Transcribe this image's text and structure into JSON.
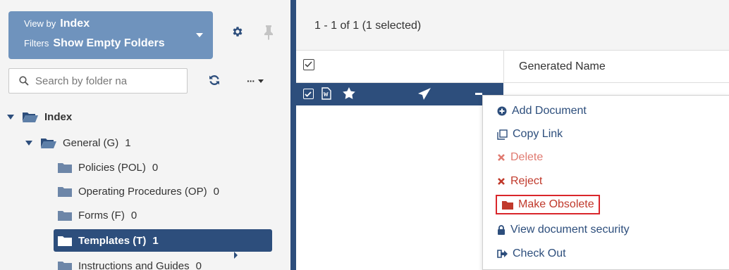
{
  "view_box": {
    "view_by_label": "View by",
    "view_by_value": "Index",
    "filters_label": "Filters",
    "filters_value": "Show Empty Folders"
  },
  "search": {
    "placeholder": "Search by folder na"
  },
  "more_label": "···",
  "tree": {
    "root": {
      "label": "Index"
    },
    "general": {
      "label": "General (G)",
      "count": "1"
    },
    "children": [
      {
        "label": "Policies (POL)",
        "count": "0"
      },
      {
        "label": "Operating Procedures (OP)",
        "count": "0"
      },
      {
        "label": "Forms (F)",
        "count": "0"
      },
      {
        "label": "Templates (T)",
        "count": "1"
      },
      {
        "label": "Instructions and Guides",
        "count": "0"
      }
    ]
  },
  "results": {
    "count_text": "1 - 1 of 1 (1 selected)",
    "column_header": "Generated Name"
  },
  "context_menu": {
    "items": [
      {
        "label": "Add Document",
        "icon": "plus-circle-icon"
      },
      {
        "label": "Copy Link",
        "icon": "copy-icon"
      },
      {
        "label": "Delete",
        "icon": "x-icon"
      },
      {
        "label": "Reject",
        "icon": "x-icon"
      },
      {
        "label": "Make Obsolete",
        "icon": "folder-icon"
      },
      {
        "label": "View document security",
        "icon": "lock-icon"
      },
      {
        "label": "Check Out",
        "icon": "checkout-icon"
      }
    ]
  },
  "colors": {
    "navy": "#2d4e7c",
    "view_box": "#6f93bd",
    "danger": "#c0392b",
    "danger_disabled": "#e07a70",
    "highlight_border": "#d9262b"
  }
}
